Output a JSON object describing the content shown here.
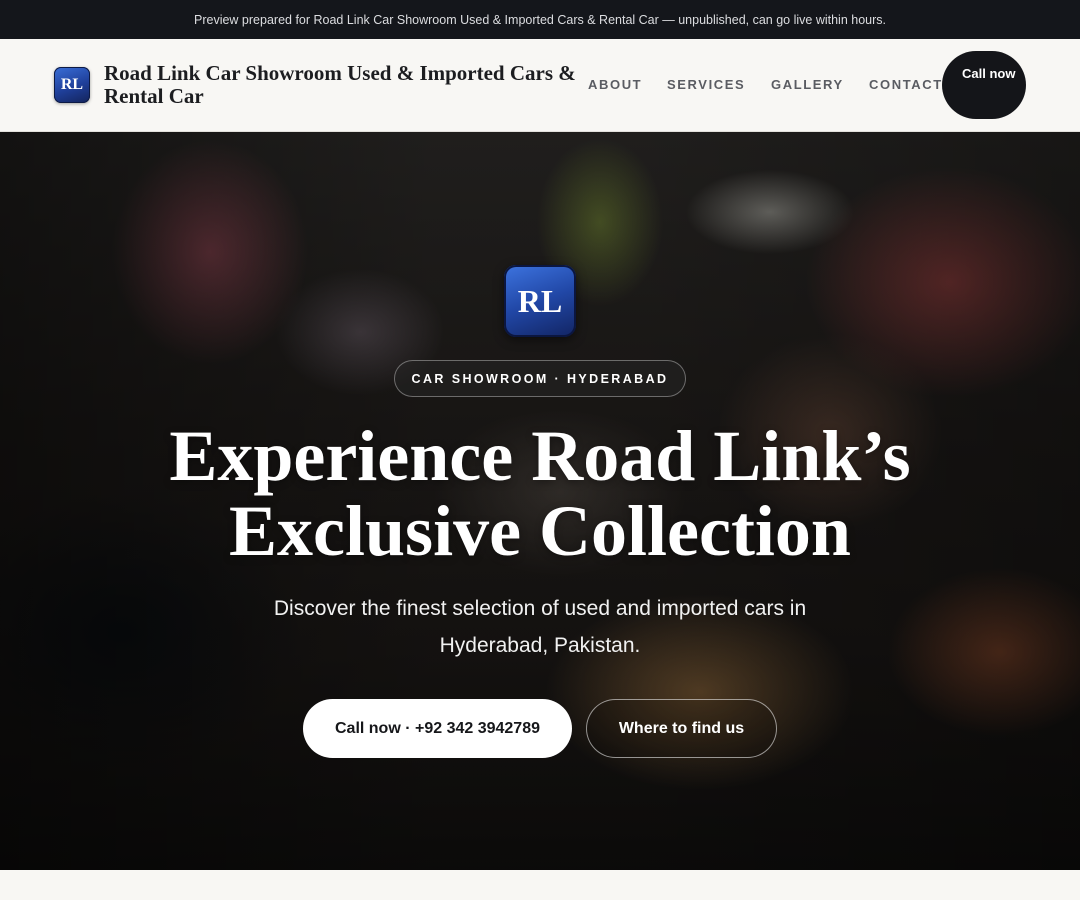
{
  "preview_banner": "Preview prepared for Road Link Car Showroom Used & Imported Cars & Rental Car — unpublished, can go live within hours.",
  "header": {
    "logo_text": "RL",
    "brand_name": "Road Link Car Showroom Used & Imported Cars & Rental Car",
    "nav": [
      "ABOUT",
      "SERVICES",
      "GALLERY",
      "CONTACT"
    ],
    "call_button": "Call now"
  },
  "hero": {
    "logo_text": "RL",
    "badge": "CAR SHOWROOM · HYDERABAD",
    "title": "Experience Road Link’s Exclusive Collection",
    "subtitle": "Discover the finest selection of used and imported cars in Hyderabad, Pakistan.",
    "primary_button": "Call now · +92 342 3942789",
    "secondary_button": "Where to find us"
  },
  "colors": {
    "topbar_bg": "#14161b",
    "logo_blue": "#2147a6",
    "dark_button": "#141519"
  }
}
